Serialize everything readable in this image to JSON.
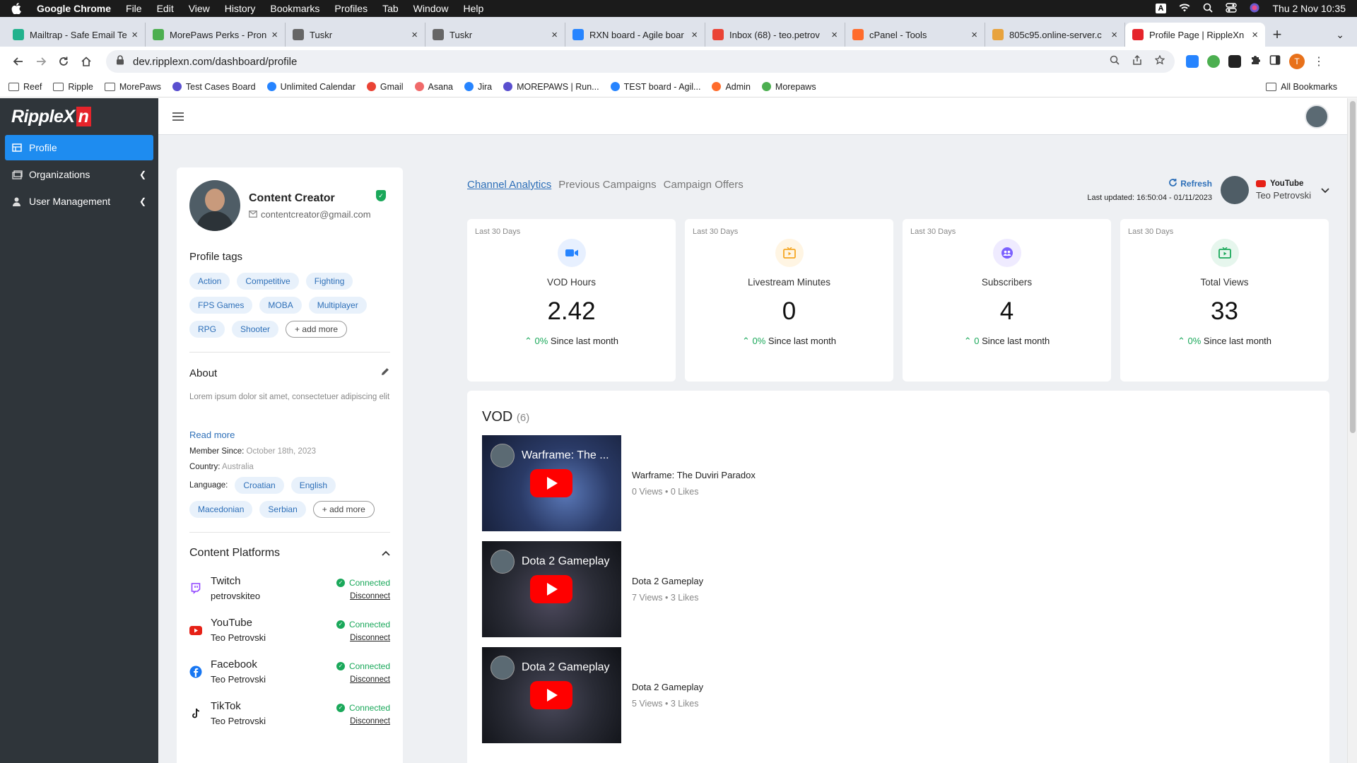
{
  "os_menubar": {
    "app": "Google Chrome",
    "menus": [
      "File",
      "Edit",
      "View",
      "History",
      "Bookmarks",
      "Profiles",
      "Tab",
      "Window",
      "Help"
    ],
    "input_indicator": "A",
    "datetime": "Thu 2 Nov  10:35"
  },
  "tabs": [
    {
      "title": "Mailtrap - Safe Email Te",
      "color": "#22b28d"
    },
    {
      "title": "MorePaws Perks - Pron",
      "color": "#4caf50"
    },
    {
      "title": "Tuskr",
      "color": "#666666"
    },
    {
      "title": "Tuskr",
      "color": "#666666"
    },
    {
      "title": "RXN board - Agile boar",
      "color": "#2684ff"
    },
    {
      "title": "Inbox (68) - teo.petrov",
      "color": "#ea4335"
    },
    {
      "title": "cPanel - Tools",
      "color": "#ff6c2c"
    },
    {
      "title": "805c95.online-server.c",
      "color": "#e8a33d"
    },
    {
      "title": "Profile Page | RippleXn",
      "color": "#e5242b",
      "active": true
    }
  ],
  "address_bar": {
    "url": "dev.ripplexn.com/dashboard/profile"
  },
  "profile_initial": "T",
  "bookmarks": [
    {
      "label": "Reef",
      "icon": "folder-icon"
    },
    {
      "label": "Ripple",
      "icon": "folder-icon"
    },
    {
      "label": "MorePaws",
      "icon": "folder-icon"
    },
    {
      "label": "Test Cases Board",
      "icon": "tuskr-icon"
    },
    {
      "label": "Unlimited Calendar",
      "icon": "calendar-icon"
    },
    {
      "label": "Gmail",
      "icon": "gmail-icon"
    },
    {
      "label": "Asana",
      "icon": "asana-icon"
    },
    {
      "label": "Jira",
      "icon": "jira-icon"
    },
    {
      "label": "MOREPAWS | Run...",
      "icon": "tuskr-icon"
    },
    {
      "label": "TEST board - Agil...",
      "icon": "jira-icon"
    },
    {
      "label": "Admin",
      "icon": "cpanel-icon"
    },
    {
      "label": "Morepaws",
      "icon": "paw-icon"
    }
  ],
  "all_bookmarks": "All Bookmarks",
  "brand": {
    "logo_text": "RippleX",
    "logo_mark": "n"
  },
  "sidebar": {
    "items": [
      {
        "label": "Profile",
        "active": true
      },
      {
        "label": "Organizations"
      },
      {
        "label": "User Management"
      }
    ]
  },
  "profile": {
    "name": "Content Creator",
    "email": "contentcreator@gmail.com",
    "tags_title": "Profile tags",
    "tags": [
      "Action",
      "Competitive",
      "Fighting",
      "FPS Games",
      "MOBA",
      "Multiplayer",
      "RPG",
      "Shooter"
    ],
    "add_more": "+ add more",
    "about_title": "About",
    "about_text": "Lorem ipsum dolor sit amet, consectetuer adipiscing elit. Aenean com",
    "read_more": "Read more",
    "member_since_label": "Member Since:",
    "member_since": "October 18th, 2023",
    "country_label": "Country:",
    "country": "Australia",
    "language_label": "Language:",
    "languages": [
      "Croatian",
      "English",
      "Macedonian",
      "Serbian"
    ],
    "platforms_title": "Content Platforms",
    "connected_label": "Connected",
    "disconnect_label": "Disconnect",
    "platforms": [
      {
        "name": "Twitch",
        "user": "petrovskiteo",
        "color": "#9146ff"
      },
      {
        "name": "YouTube",
        "user": "Teo Petrovski",
        "color": "#e62117"
      },
      {
        "name": "Facebook",
        "user": "Teo Petrovski",
        "color": "#1877f2"
      },
      {
        "name": "TikTok",
        "user": "Teo Petrovski",
        "color": "#111111"
      }
    ]
  },
  "analytics": {
    "tabs": [
      "Channel Analytics",
      "Previous Campaigns",
      "Campaign Offers"
    ],
    "refresh": "Refresh",
    "last_updated": "Last updated: 16:50:04 - 01/11/2023",
    "channel_platform": "YouTube",
    "channel_user": "Teo Petrovski",
    "period_label": "Last 30 Days",
    "stats": [
      {
        "name": "VOD Hours",
        "value": "2.42",
        "change": "0%",
        "since": "Since last month",
        "icon_color": "#2684ff",
        "icon_bg": "#e7f0ff"
      },
      {
        "name": "Livestream Minutes",
        "value": "0",
        "change": "0%",
        "since": "Since last month",
        "icon_color": "#f5a623",
        "icon_bg": "#fff5e3"
      },
      {
        "name": "Subscribers",
        "value": "4",
        "change": "0",
        "since": "Since last month",
        "icon_color": "#7b61ff",
        "icon_bg": "#efebff"
      },
      {
        "name": "Total Views",
        "value": "33",
        "change": "0%",
        "since": "Since last month",
        "icon_color": "#1aa85a",
        "icon_bg": "#e6f6ed"
      }
    ]
  },
  "vod": {
    "title": "VOD",
    "count": "(6)",
    "videos": [
      {
        "thumb_title": "Warframe: The ...",
        "title": "Warframe: The Duviri Paradox",
        "views": "0 Views",
        "likes": "0 Likes",
        "tint": "#3b4f86"
      },
      {
        "thumb_title": "Dota 2 Gameplay",
        "title": "Dota 2 Gameplay",
        "views": "7 Views",
        "likes": "3 Likes",
        "tint": "#3b3e4a"
      },
      {
        "thumb_title": "Dota 2 Gameplay",
        "title": "Dota 2 Gameplay",
        "views": "5 Views",
        "likes": "3 Likes",
        "tint": "#393a46"
      }
    ]
  }
}
